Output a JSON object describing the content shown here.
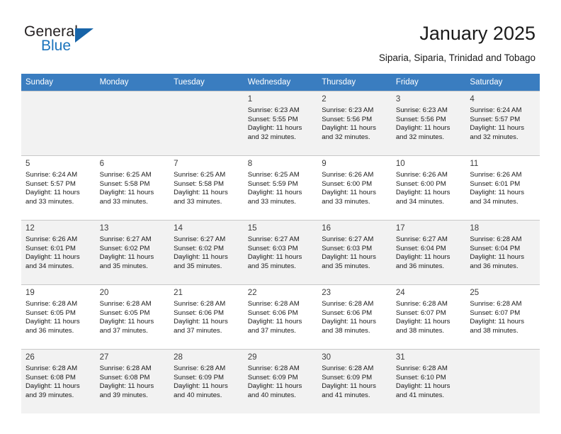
{
  "brand": {
    "name_part1": "General",
    "name_part2": "Blue",
    "triangle_color": "#1764a8",
    "blue_text_color": "#1b74bd"
  },
  "header": {
    "title": "January 2025",
    "subtitle": "Siparia, Siparia, Trinidad and Tobago"
  },
  "theme": {
    "header_row_bg": "#3a7dc0",
    "header_row_text": "#ffffff",
    "shaded_row_bg": "#f2f2f2",
    "grid_line": "#c8c8c8"
  },
  "weekday_headers": [
    "Sunday",
    "Monday",
    "Tuesday",
    "Wednesday",
    "Thursday",
    "Friday",
    "Saturday"
  ],
  "weeks": [
    {
      "shaded": true,
      "days": [
        {
          "num": "",
          "sunrise": "",
          "sunset": "",
          "daylight1": "",
          "daylight2": "",
          "empty": true
        },
        {
          "num": "",
          "sunrise": "",
          "sunset": "",
          "daylight1": "",
          "daylight2": "",
          "empty": true
        },
        {
          "num": "",
          "sunrise": "",
          "sunset": "",
          "daylight1": "",
          "daylight2": "",
          "empty": true
        },
        {
          "num": "1",
          "sunrise": "Sunrise: 6:23 AM",
          "sunset": "Sunset: 5:55 PM",
          "daylight1": "Daylight: 11 hours",
          "daylight2": "and 32 minutes.",
          "empty": false
        },
        {
          "num": "2",
          "sunrise": "Sunrise: 6:23 AM",
          "sunset": "Sunset: 5:56 PM",
          "daylight1": "Daylight: 11 hours",
          "daylight2": "and 32 minutes.",
          "empty": false
        },
        {
          "num": "3",
          "sunrise": "Sunrise: 6:23 AM",
          "sunset": "Sunset: 5:56 PM",
          "daylight1": "Daylight: 11 hours",
          "daylight2": "and 32 minutes.",
          "empty": false
        },
        {
          "num": "4",
          "sunrise": "Sunrise: 6:24 AM",
          "sunset": "Sunset: 5:57 PM",
          "daylight1": "Daylight: 11 hours",
          "daylight2": "and 32 minutes.",
          "empty": false
        }
      ]
    },
    {
      "shaded": false,
      "days": [
        {
          "num": "5",
          "sunrise": "Sunrise: 6:24 AM",
          "sunset": "Sunset: 5:57 PM",
          "daylight1": "Daylight: 11 hours",
          "daylight2": "and 33 minutes.",
          "empty": false
        },
        {
          "num": "6",
          "sunrise": "Sunrise: 6:25 AM",
          "sunset": "Sunset: 5:58 PM",
          "daylight1": "Daylight: 11 hours",
          "daylight2": "and 33 minutes.",
          "empty": false
        },
        {
          "num": "7",
          "sunrise": "Sunrise: 6:25 AM",
          "sunset": "Sunset: 5:58 PM",
          "daylight1": "Daylight: 11 hours",
          "daylight2": "and 33 minutes.",
          "empty": false
        },
        {
          "num": "8",
          "sunrise": "Sunrise: 6:25 AM",
          "sunset": "Sunset: 5:59 PM",
          "daylight1": "Daylight: 11 hours",
          "daylight2": "and 33 minutes.",
          "empty": false
        },
        {
          "num": "9",
          "sunrise": "Sunrise: 6:26 AM",
          "sunset": "Sunset: 6:00 PM",
          "daylight1": "Daylight: 11 hours",
          "daylight2": "and 33 minutes.",
          "empty": false
        },
        {
          "num": "10",
          "sunrise": "Sunrise: 6:26 AM",
          "sunset": "Sunset: 6:00 PM",
          "daylight1": "Daylight: 11 hours",
          "daylight2": "and 34 minutes.",
          "empty": false
        },
        {
          "num": "11",
          "sunrise": "Sunrise: 6:26 AM",
          "sunset": "Sunset: 6:01 PM",
          "daylight1": "Daylight: 11 hours",
          "daylight2": "and 34 minutes.",
          "empty": false
        }
      ]
    },
    {
      "shaded": true,
      "days": [
        {
          "num": "12",
          "sunrise": "Sunrise: 6:26 AM",
          "sunset": "Sunset: 6:01 PM",
          "daylight1": "Daylight: 11 hours",
          "daylight2": "and 34 minutes.",
          "empty": false
        },
        {
          "num": "13",
          "sunrise": "Sunrise: 6:27 AM",
          "sunset": "Sunset: 6:02 PM",
          "daylight1": "Daylight: 11 hours",
          "daylight2": "and 35 minutes.",
          "empty": false
        },
        {
          "num": "14",
          "sunrise": "Sunrise: 6:27 AM",
          "sunset": "Sunset: 6:02 PM",
          "daylight1": "Daylight: 11 hours",
          "daylight2": "and 35 minutes.",
          "empty": false
        },
        {
          "num": "15",
          "sunrise": "Sunrise: 6:27 AM",
          "sunset": "Sunset: 6:03 PM",
          "daylight1": "Daylight: 11 hours",
          "daylight2": "and 35 minutes.",
          "empty": false
        },
        {
          "num": "16",
          "sunrise": "Sunrise: 6:27 AM",
          "sunset": "Sunset: 6:03 PM",
          "daylight1": "Daylight: 11 hours",
          "daylight2": "and 35 minutes.",
          "empty": false
        },
        {
          "num": "17",
          "sunrise": "Sunrise: 6:27 AM",
          "sunset": "Sunset: 6:04 PM",
          "daylight1": "Daylight: 11 hours",
          "daylight2": "and 36 minutes.",
          "empty": false
        },
        {
          "num": "18",
          "sunrise": "Sunrise: 6:28 AM",
          "sunset": "Sunset: 6:04 PM",
          "daylight1": "Daylight: 11 hours",
          "daylight2": "and 36 minutes.",
          "empty": false
        }
      ]
    },
    {
      "shaded": false,
      "days": [
        {
          "num": "19",
          "sunrise": "Sunrise: 6:28 AM",
          "sunset": "Sunset: 6:05 PM",
          "daylight1": "Daylight: 11 hours",
          "daylight2": "and 36 minutes.",
          "empty": false
        },
        {
          "num": "20",
          "sunrise": "Sunrise: 6:28 AM",
          "sunset": "Sunset: 6:05 PM",
          "daylight1": "Daylight: 11 hours",
          "daylight2": "and 37 minutes.",
          "empty": false
        },
        {
          "num": "21",
          "sunrise": "Sunrise: 6:28 AM",
          "sunset": "Sunset: 6:06 PM",
          "daylight1": "Daylight: 11 hours",
          "daylight2": "and 37 minutes.",
          "empty": false
        },
        {
          "num": "22",
          "sunrise": "Sunrise: 6:28 AM",
          "sunset": "Sunset: 6:06 PM",
          "daylight1": "Daylight: 11 hours",
          "daylight2": "and 37 minutes.",
          "empty": false
        },
        {
          "num": "23",
          "sunrise": "Sunrise: 6:28 AM",
          "sunset": "Sunset: 6:06 PM",
          "daylight1": "Daylight: 11 hours",
          "daylight2": "and 38 minutes.",
          "empty": false
        },
        {
          "num": "24",
          "sunrise": "Sunrise: 6:28 AM",
          "sunset": "Sunset: 6:07 PM",
          "daylight1": "Daylight: 11 hours",
          "daylight2": "and 38 minutes.",
          "empty": false
        },
        {
          "num": "25",
          "sunrise": "Sunrise: 6:28 AM",
          "sunset": "Sunset: 6:07 PM",
          "daylight1": "Daylight: 11 hours",
          "daylight2": "and 38 minutes.",
          "empty": false
        }
      ]
    },
    {
      "shaded": true,
      "days": [
        {
          "num": "26",
          "sunrise": "Sunrise: 6:28 AM",
          "sunset": "Sunset: 6:08 PM",
          "daylight1": "Daylight: 11 hours",
          "daylight2": "and 39 minutes.",
          "empty": false
        },
        {
          "num": "27",
          "sunrise": "Sunrise: 6:28 AM",
          "sunset": "Sunset: 6:08 PM",
          "daylight1": "Daylight: 11 hours",
          "daylight2": "and 39 minutes.",
          "empty": false
        },
        {
          "num": "28",
          "sunrise": "Sunrise: 6:28 AM",
          "sunset": "Sunset: 6:09 PM",
          "daylight1": "Daylight: 11 hours",
          "daylight2": "and 40 minutes.",
          "empty": false
        },
        {
          "num": "29",
          "sunrise": "Sunrise: 6:28 AM",
          "sunset": "Sunset: 6:09 PM",
          "daylight1": "Daylight: 11 hours",
          "daylight2": "and 40 minutes.",
          "empty": false
        },
        {
          "num": "30",
          "sunrise": "Sunrise: 6:28 AM",
          "sunset": "Sunset: 6:09 PM",
          "daylight1": "Daylight: 11 hours",
          "daylight2": "and 41 minutes.",
          "empty": false
        },
        {
          "num": "31",
          "sunrise": "Sunrise: 6:28 AM",
          "sunset": "Sunset: 6:10 PM",
          "daylight1": "Daylight: 11 hours",
          "daylight2": "and 41 minutes.",
          "empty": false
        },
        {
          "num": "",
          "sunrise": "",
          "sunset": "",
          "daylight1": "",
          "daylight2": "",
          "empty": true
        }
      ]
    }
  ]
}
